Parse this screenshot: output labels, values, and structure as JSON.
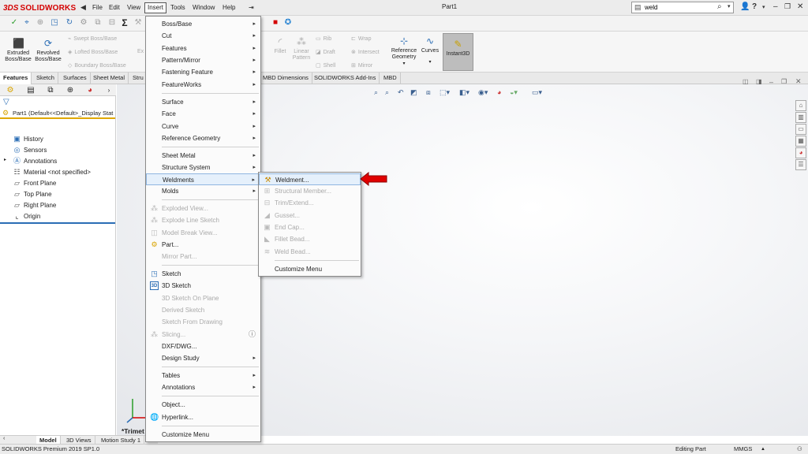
{
  "app": {
    "brand_ds": "3DS",
    "brand_name": "SOLIDWORKS",
    "doc_title": "Part1",
    "menubar": [
      "File",
      "Edit",
      "View",
      "Insert",
      "Tools",
      "Window",
      "Help"
    ],
    "search_value": "weld",
    "help_label": "?"
  },
  "command_manager": {
    "extruded": "Extruded Boss/Base",
    "revolved": "Revolved Boss/Base",
    "swept": "Swept Boss/Base",
    "lofted": "Lofted Boss/Base",
    "boundary": "Boundary Boss/Base",
    "ex": "Ex",
    "fillet": "Fillet",
    "linear_pattern": "Linear Pattern",
    "rib": "Rib",
    "draft": "Draft",
    "shell": "Shell",
    "wrap": "Wrap",
    "intersect": "Intersect",
    "mirror": "Mirror",
    "reference_geometry": "Reference Geometry",
    "curves": "Curves",
    "instant3d": "Instant3D"
  },
  "tabs": [
    "Features",
    "Sketch",
    "Surfaces",
    "Sheet Metal",
    "Stru",
    "MBD Dimensions",
    "SOLIDWORKS Add-Ins",
    "MBD"
  ],
  "tree": {
    "root": "Part1  (Default<<Default>_Display Stat",
    "items": [
      "History",
      "Sensors",
      "Annotations",
      "Material <not specified>",
      "Front Plane",
      "Top Plane",
      "Right Plane",
      "Origin"
    ]
  },
  "insert_menu": {
    "items": [
      {
        "label": "Boss/Base"
      },
      {
        "label": "Cut"
      },
      {
        "label": "Features"
      },
      {
        "label": "Pattern/Mirror"
      },
      {
        "label": "Fastening Feature"
      },
      {
        "label": "FeatureWorks"
      },
      {
        "label": "Surface"
      },
      {
        "label": "Face"
      },
      {
        "label": "Curve"
      },
      {
        "label": "Reference Geometry"
      },
      {
        "label": "Sheet Metal"
      },
      {
        "label": "Structure System"
      },
      {
        "label": "Weldments"
      },
      {
        "label": "Molds"
      },
      {
        "label": "Exploded View..."
      },
      {
        "label": "Explode Line Sketch"
      },
      {
        "label": "Model Break View..."
      },
      {
        "label": "Part..."
      },
      {
        "label": "Mirror Part..."
      },
      {
        "label": "Sketch"
      },
      {
        "label": "3D Sketch"
      },
      {
        "label": "3D Sketch On Plane"
      },
      {
        "label": "Derived Sketch"
      },
      {
        "label": "Sketch From Drawing"
      },
      {
        "label": "Slicing..."
      },
      {
        "label": "DXF/DWG..."
      },
      {
        "label": "Design Study"
      },
      {
        "label": "Tables"
      },
      {
        "label": "Annotations"
      },
      {
        "label": "Object..."
      },
      {
        "label": "Hyperlink..."
      },
      {
        "label": "Customize Menu"
      }
    ]
  },
  "weldments_menu": {
    "items": [
      {
        "label": "Weldment..."
      },
      {
        "label": "Structural Member..."
      },
      {
        "label": "Trim/Extend..."
      },
      {
        "label": "Gusset..."
      },
      {
        "label": "End Cap..."
      },
      {
        "label": "Fillet Bead..."
      },
      {
        "label": "Weld Bead..."
      },
      {
        "label": "Customize Menu"
      }
    ]
  },
  "viewport": {
    "trimetric": "*Trimet"
  },
  "bottom_tabs": [
    "Model",
    "3D Views",
    "Motion Study 1"
  ],
  "status": {
    "product": "SOLIDWORKS Premium 2019 SP1.0",
    "mode": "Editing Part",
    "units": "MMGS"
  },
  "colors": {
    "brand_red": "#d40000",
    "highlight_arrow": "#e00000",
    "menu_highlight": "#e5f0fb"
  }
}
